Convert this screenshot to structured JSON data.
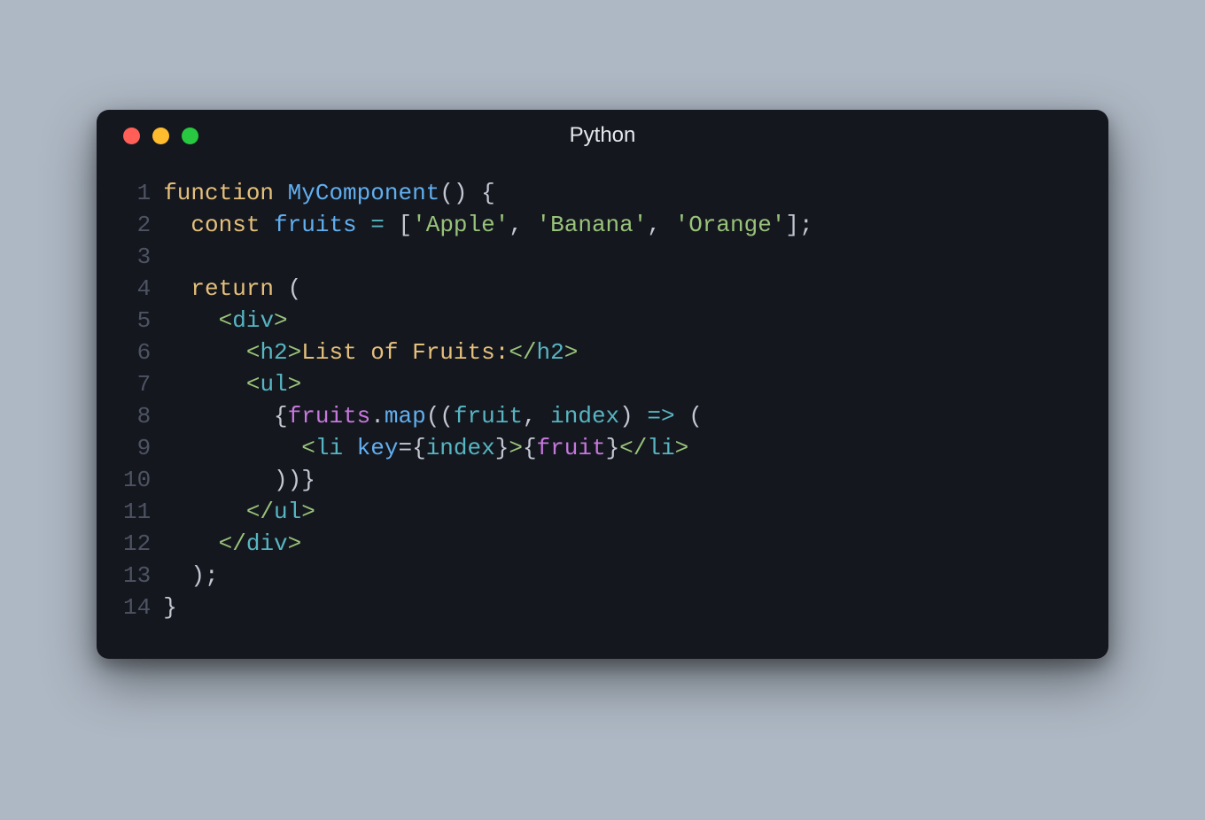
{
  "window": {
    "title": "Python",
    "traffic": {
      "red": "#ff5f57",
      "yellow": "#febc2e",
      "green": "#28c840"
    }
  },
  "code": {
    "lines": [
      {
        "n": "1",
        "tokens": [
          {
            "t": "function",
            "c": "c-keyword"
          },
          {
            "t": " ",
            "c": "c-default"
          },
          {
            "t": "MyComponent",
            "c": "c-func"
          },
          {
            "t": "()",
            "c": "c-punc"
          },
          {
            "t": " ",
            "c": "c-default"
          },
          {
            "t": "{",
            "c": "c-punc"
          }
        ]
      },
      {
        "n": "2",
        "tokens": [
          {
            "t": "  ",
            "c": "c-default"
          },
          {
            "t": "const",
            "c": "c-keyword"
          },
          {
            "t": " ",
            "c": "c-default"
          },
          {
            "t": "fruits",
            "c": "c-ident"
          },
          {
            "t": " ",
            "c": "c-default"
          },
          {
            "t": "=",
            "c": "c-assign"
          },
          {
            "t": " ",
            "c": "c-default"
          },
          {
            "t": "[",
            "c": "c-punc"
          },
          {
            "t": "'Apple'",
            "c": "c-str"
          },
          {
            "t": ", ",
            "c": "c-punc"
          },
          {
            "t": "'Banana'",
            "c": "c-str"
          },
          {
            "t": ", ",
            "c": "c-punc"
          },
          {
            "t": "'Orange'",
            "c": "c-str"
          },
          {
            "t": "];",
            "c": "c-punc"
          }
        ]
      },
      {
        "n": "3",
        "tokens": [
          {
            "t": "",
            "c": "c-default"
          }
        ]
      },
      {
        "n": "4",
        "tokens": [
          {
            "t": "  ",
            "c": "c-default"
          },
          {
            "t": "return",
            "c": "c-keyword"
          },
          {
            "t": " ",
            "c": "c-default"
          },
          {
            "t": "(",
            "c": "c-punc"
          }
        ]
      },
      {
        "n": "5",
        "tokens": [
          {
            "t": "    ",
            "c": "c-default"
          },
          {
            "t": "<",
            "c": "c-tag"
          },
          {
            "t": "div",
            "c": "c-tagname"
          },
          {
            "t": ">",
            "c": "c-tag"
          }
        ]
      },
      {
        "n": "6",
        "tokens": [
          {
            "t": "      ",
            "c": "c-default"
          },
          {
            "t": "<",
            "c": "c-tag"
          },
          {
            "t": "h2",
            "c": "c-tagname"
          },
          {
            "t": ">",
            "c": "c-tag"
          },
          {
            "t": "List of Fruits:",
            "c": "c-text"
          },
          {
            "t": "</",
            "c": "c-tag"
          },
          {
            "t": "h2",
            "c": "c-tagname"
          },
          {
            "t": ">",
            "c": "c-tag"
          }
        ]
      },
      {
        "n": "7",
        "tokens": [
          {
            "t": "      ",
            "c": "c-default"
          },
          {
            "t": "<",
            "c": "c-tag"
          },
          {
            "t": "ul",
            "c": "c-tagname"
          },
          {
            "t": ">",
            "c": "c-tag"
          }
        ]
      },
      {
        "n": "8",
        "tokens": [
          {
            "t": "        ",
            "c": "c-default"
          },
          {
            "t": "{",
            "c": "c-punc"
          },
          {
            "t": "fruits",
            "c": "c-var"
          },
          {
            "t": ".",
            "c": "c-punc"
          },
          {
            "t": "map",
            "c": "c-func"
          },
          {
            "t": "((",
            "c": "c-punc"
          },
          {
            "t": "fruit",
            "c": "c-param"
          },
          {
            "t": ", ",
            "c": "c-punc"
          },
          {
            "t": "index",
            "c": "c-param"
          },
          {
            "t": ") ",
            "c": "c-punc"
          },
          {
            "t": "=>",
            "c": "c-assign"
          },
          {
            "t": " (",
            "c": "c-punc"
          }
        ]
      },
      {
        "n": "9",
        "tokens": [
          {
            "t": "          ",
            "c": "c-default"
          },
          {
            "t": "<",
            "c": "c-tag"
          },
          {
            "t": "li",
            "c": "c-tagname"
          },
          {
            "t": " ",
            "c": "c-default"
          },
          {
            "t": "key",
            "c": "c-attr"
          },
          {
            "t": "={",
            "c": "c-punc"
          },
          {
            "t": "index",
            "c": "c-param"
          },
          {
            "t": "}",
            "c": "c-punc"
          },
          {
            "t": ">",
            "c": "c-tag"
          },
          {
            "t": "{",
            "c": "c-punc"
          },
          {
            "t": "fruit",
            "c": "c-var"
          },
          {
            "t": "}",
            "c": "c-punc"
          },
          {
            "t": "</",
            "c": "c-tag"
          },
          {
            "t": "li",
            "c": "c-tagname"
          },
          {
            "t": ">",
            "c": "c-tag"
          }
        ]
      },
      {
        "n": "10",
        "tokens": [
          {
            "t": "        ",
            "c": "c-default"
          },
          {
            "t": "))}",
            "c": "c-punc"
          }
        ]
      },
      {
        "n": "11",
        "tokens": [
          {
            "t": "      ",
            "c": "c-default"
          },
          {
            "t": "</",
            "c": "c-tag"
          },
          {
            "t": "ul",
            "c": "c-tagname"
          },
          {
            "t": ">",
            "c": "c-tag"
          }
        ]
      },
      {
        "n": "12",
        "tokens": [
          {
            "t": "    ",
            "c": "c-default"
          },
          {
            "t": "</",
            "c": "c-tag"
          },
          {
            "t": "div",
            "c": "c-tagname"
          },
          {
            "t": ">",
            "c": "c-tag"
          }
        ]
      },
      {
        "n": "13",
        "tokens": [
          {
            "t": "  ",
            "c": "c-default"
          },
          {
            "t": ");",
            "c": "c-punc"
          }
        ]
      },
      {
        "n": "14",
        "tokens": [
          {
            "t": "}",
            "c": "c-punc"
          }
        ]
      }
    ]
  }
}
